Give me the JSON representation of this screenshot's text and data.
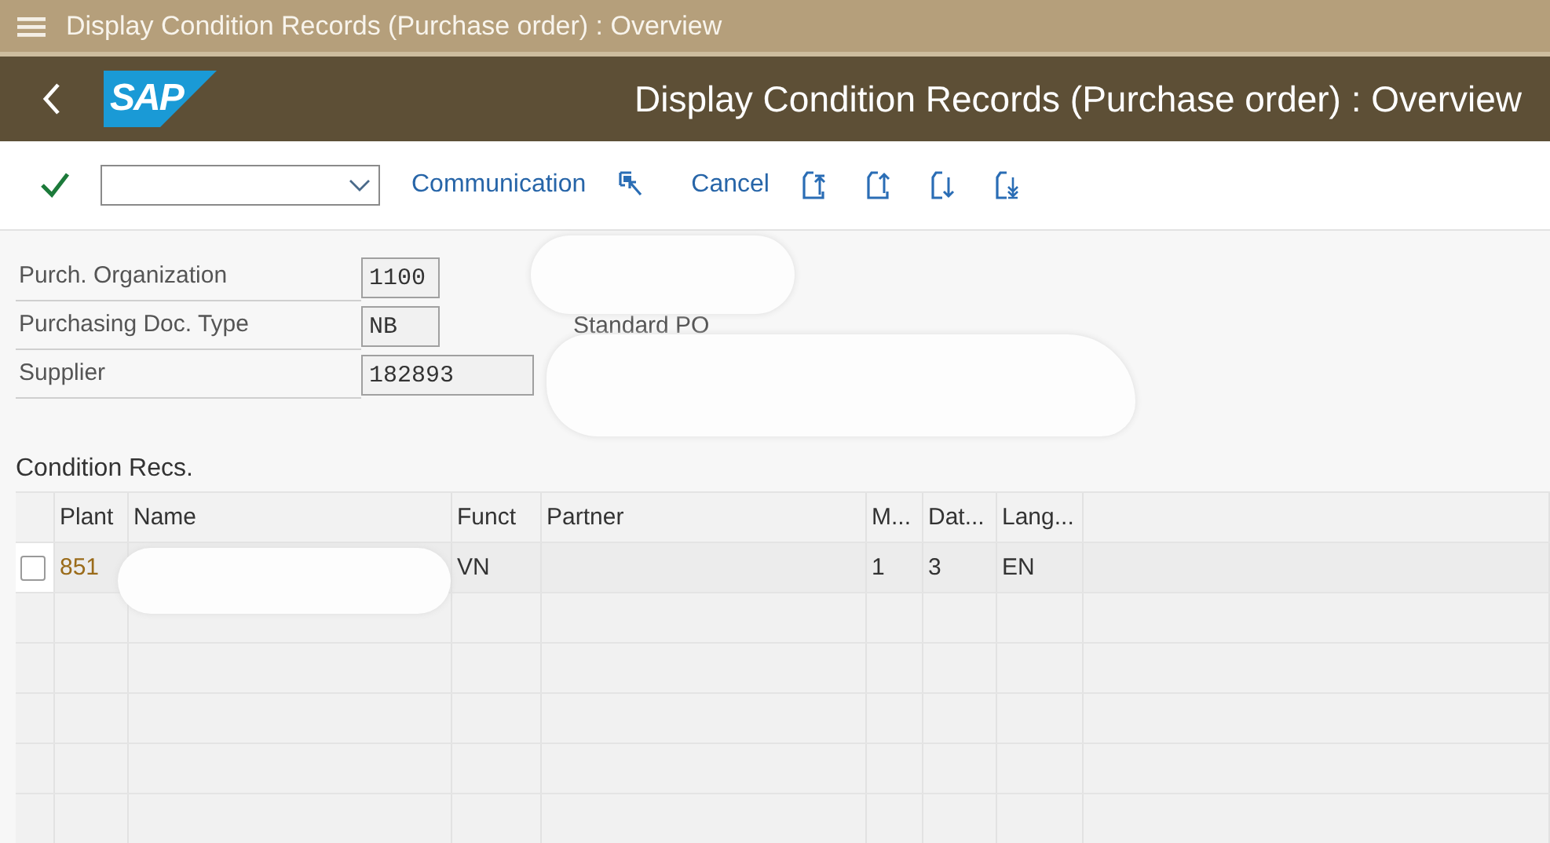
{
  "window": {
    "title": "Display Condition Records (Purchase order) : Overview"
  },
  "header": {
    "logo": "SAP",
    "title": "Display Condition Records (Purchase order) : Overview"
  },
  "toolbar": {
    "buttons": [
      {
        "kind": "text",
        "label": "Communication"
      },
      {
        "kind": "icon"
      },
      {
        "kind": "text",
        "label": "Cancel"
      },
      {
        "kind": "icon"
      },
      {
        "kind": "icon"
      },
      {
        "kind": "icon"
      },
      {
        "kind": "icon"
      }
    ]
  },
  "fields": [
    {
      "label": "Purch. Organization",
      "value": "1100"
    },
    {
      "label": "Purchasing Doc. Type",
      "value": "NB",
      "description": "Standard PO"
    },
    {
      "label": "Supplier",
      "value": "182893"
    }
  ],
  "table": {
    "title": "Condition Recs.",
    "columns": [
      "Plant",
      "Name",
      "Funct",
      "Partner",
      "M...",
      "Dat...",
      "Lang..."
    ],
    "rows": [
      {
        "checked": false,
        "cells": [
          "851",
          "",
          "VN",
          "",
          "1",
          "3",
          "EN"
        ]
      }
    ]
  }
}
